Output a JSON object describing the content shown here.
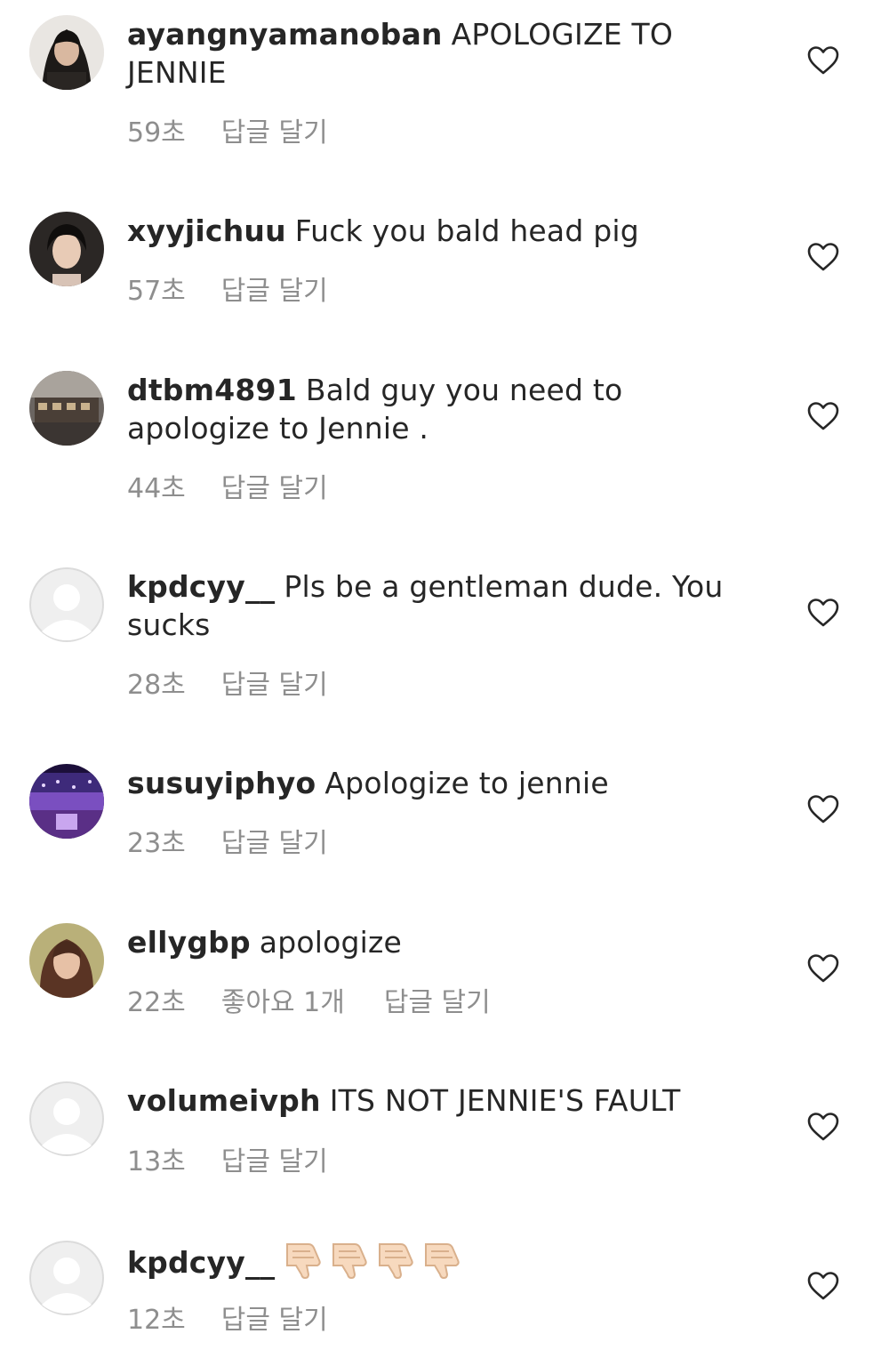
{
  "colors": {
    "text": "#262626",
    "meta": "#8e8e8e",
    "avatar_default": "#efefef",
    "skin": "#f7d9be"
  },
  "comments": [
    {
      "username": "ayangnyamanoban",
      "text": "APOLOGIZE TO JENNIE",
      "time": "59초",
      "reply": "답글 달기",
      "avatar": "photo-dark-hair-icon"
    },
    {
      "username": "xyyjichuu",
      "text": "Fuck you bald head pig",
      "time": "57초",
      "reply": "답글 달기",
      "avatar": "photo-portrait-icon"
    },
    {
      "username": "dtbm4891",
      "text": "Bald guy you need to apologize to Jennie .",
      "time": "44초",
      "reply": "답글 달기",
      "avatar": "photo-cafe-icon"
    },
    {
      "username": "kpdcyy__",
      "text": "Pls be a gentleman dude. You sucks",
      "time": "28초",
      "reply": "답글 달기",
      "avatar": "default-avatar-icon"
    },
    {
      "username": "susuyiphyo",
      "text": "Apologize to jennie",
      "time": "23초",
      "reply": "답글 달기",
      "avatar": "photo-concert-icon"
    },
    {
      "username": "ellygbp",
      "text": "apologize",
      "time": "22초",
      "likes": "좋아요 1개",
      "reply": "답글 달기",
      "avatar": "photo-woman-icon"
    },
    {
      "username": "volumeivph",
      "text": "ITS NOT JENNIE'S FAULT",
      "time": "13초",
      "reply": "답글 달기",
      "avatar": "default-avatar-icon"
    },
    {
      "username": "kpdcyy__",
      "text": "",
      "emoji": [
        "thumbs-down-icon",
        "thumbs-down-icon",
        "thumbs-down-icon",
        "thumbs-down-icon"
      ],
      "time": "12초",
      "reply": "답글 달기",
      "avatar": "default-avatar-icon"
    }
  ]
}
